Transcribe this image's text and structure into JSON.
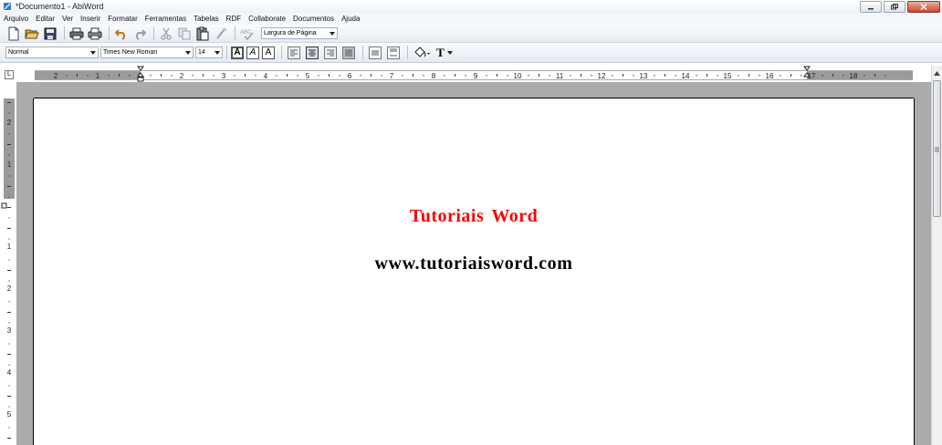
{
  "window": {
    "title": "*Documento1 - AbiWord"
  },
  "menu": [
    "Arquivo",
    "Editar",
    "Ver",
    "Inserir",
    "Formatar",
    "Ferramentas",
    "Tabelas",
    "RDF",
    "Collaborate",
    "Documentos",
    "Ajuda"
  ],
  "toolbar": {
    "zoom_value": "Largura de Página",
    "style_value": "Normal",
    "font_value": "Times New Roman",
    "size_value": "14",
    "bold_glyph": "A",
    "italic_glyph": "A",
    "underline_glyph": "A",
    "text_color_glyph": "T"
  },
  "ruler": {
    "tab_glyph": "L",
    "h_labels": [
      "2",
      "1",
      "1",
      "2",
      "3",
      "4",
      "5",
      "6",
      "7",
      "8",
      "9",
      "10",
      "11",
      "12",
      "13",
      "14",
      "15",
      "16",
      "17",
      "18"
    ],
    "v_labels": [
      "2",
      "1",
      "1",
      "2",
      "3",
      "4",
      "5"
    ]
  },
  "document": {
    "line1": "Tutoriais  Word",
    "line2": "www.tutoriaisword.com"
  }
}
